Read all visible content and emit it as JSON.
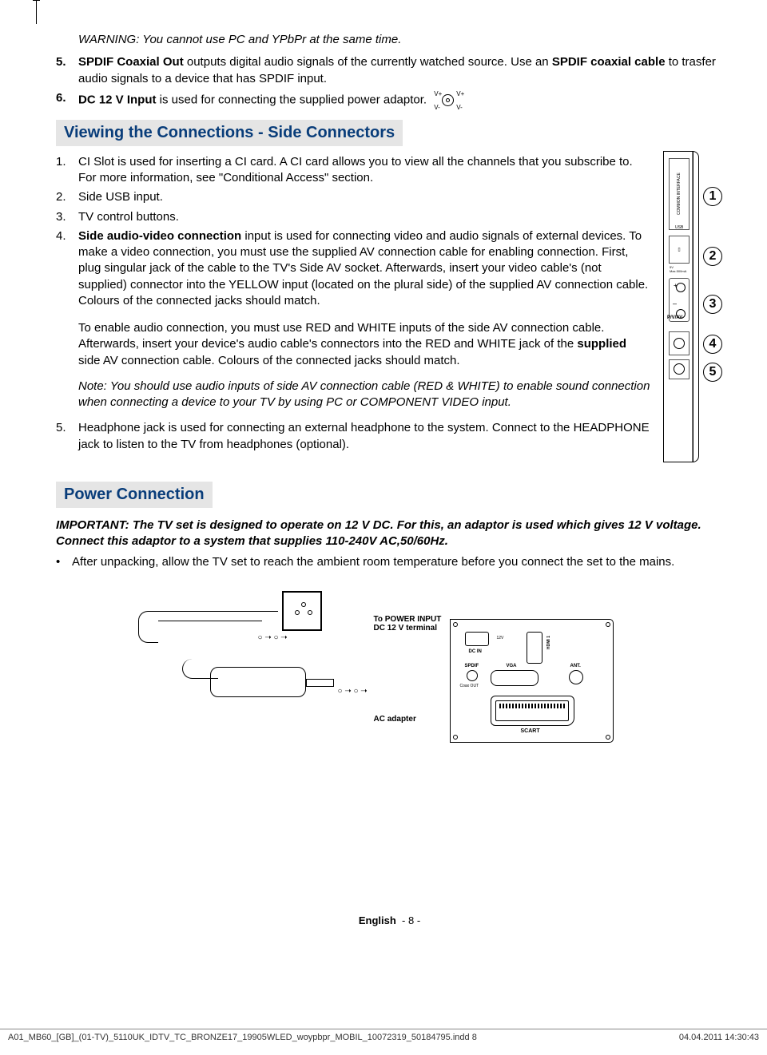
{
  "warning_line": "WARNING: You cannot use PC and YPbPr at the same time.",
  "item5": {
    "num": "5.",
    "bold_lead": "SPDIF Coaxial Out",
    "text1": " outputs digital audio signals of the currently watched source. Use an ",
    "bold_mid": "SPDIF coaxial cable",
    "text2": " to trasfer audio signals to a device that has SPDIF input."
  },
  "item6": {
    "num": "6.",
    "bold_lead": "DC 12 V Input",
    "text": " is used for connecting the supplied power adaptor."
  },
  "section_side": "Viewing the Connections - Side Connectors",
  "side1": {
    "num": "1.",
    "text": "CI Slot is used for inserting a CI card. A CI card allows you to view all the channels that you subscribe to. For more information, see \"Conditional Access\" section."
  },
  "side2": {
    "num": "2.",
    "text": "Side USB input."
  },
  "side3": {
    "num": "3.",
    "text": "TV control buttons."
  },
  "side4": {
    "num": "4.",
    "bold_lead": "Side audio-video connection",
    "text1": " input is used for connecting video and audio signals of external devices. To make a video connection, you must use the supplied AV connection cable for enabling connection. First, plug singular jack of the cable to the TV's Side AV socket. Afterwards, insert your video cable's (not supplied) connector into the YELLOW input (located on the plural side) of the supplied AV connection cable. Colours of the connected jacks should match."
  },
  "side4_para2": {
    "text1": "To enable audio connection, you must use RED and WHITE inputs of the side AV connection cable. Afterwards, insert your device's audio cable's connectors into the RED and WHITE jack of the ",
    "bold": "supplied",
    "text2": " side AV connection cable. Colours of the connected jacks should match."
  },
  "side4_note": "Note: You should use audio inputs of side AV connection cable (RED & WHITE) to enable sound connection when connecting a device to your TV by using PC or COMPONENT VIDEO input.",
  "side5": {
    "num": "5.",
    "text": "Headphone jack is used for connecting an external headphone to the system. Connect to the HEADPHONE jack to listen to the TV from headphones (optional)."
  },
  "section_power": "Power Connection",
  "power_important": "IMPORTANT: The TV set is designed to operate on 12 V DC. For this, an adaptor is used which gives 12 V voltage. Connect this adaptor to a system that supplies 110-240V AC,50/60Hz.",
  "power_bullet": "After unpacking, allow the TV set to reach the ambient room temperature before you connect the set to the mains.",
  "diagram": {
    "terminal": "To POWER INPUT DC 12 V terminal",
    "ac_adapter": "AC adapter",
    "dc_in": "DC IN",
    "spdif": "SPDIF",
    "coax": "Coax OUT",
    "vga": "VGA",
    "ant": "ANT.",
    "scart": "SCART",
    "hdmi": "HDMI 1",
    "twelve": "12V"
  },
  "polarity": {
    "vp": "V+",
    "vm": "V-"
  },
  "side_panel": {
    "ci": "COMMON INTERFACE",
    "usb": "USB",
    "max": "5V",
    "max2": "Max.500mA",
    "pv": "P/V/AV"
  },
  "callouts": {
    "c1": "1",
    "c2": "2",
    "c3": "3",
    "c4": "4",
    "c5": "5"
  },
  "footer": {
    "lang": "English",
    "page": "- 8 -",
    "file": "A01_MB60_[GB]_(01-TV)_5110UK_IDTV_TC_BRONZE17_19905WLED_woypbpr_MOBIL_10072319_50184795.indd   8",
    "date": "04.04.2011   14:30:43"
  }
}
